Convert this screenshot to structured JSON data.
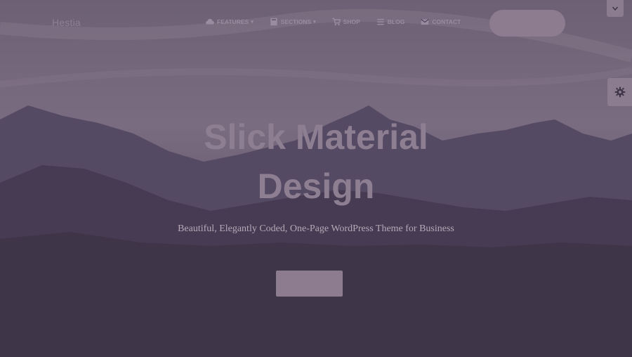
{
  "header": {
    "brand": "Hestia",
    "nav": [
      {
        "label": "Features",
        "icon": "cloud-icon",
        "has_dropdown": true
      },
      {
        "label": "Sections",
        "icon": "book-icon",
        "has_dropdown": true
      },
      {
        "label": "Shop",
        "icon": "cart-icon",
        "has_dropdown": false
      },
      {
        "label": "Blog",
        "icon": "list-icon",
        "has_dropdown": false
      },
      {
        "label": "Contact",
        "icon": "mail-icon",
        "has_dropdown": false
      }
    ],
    "dropdown_caret": "▾"
  },
  "hero": {
    "title_line1": "Slick Material",
    "title_line2": "Design",
    "subtitle": "Beautiful, Elegantly Coded, One-Page WordPress Theme for Business"
  },
  "colors": {
    "background_dark": "#3f3549",
    "accent": "#8d7c8f",
    "nav_text": "#9a8ba0"
  }
}
